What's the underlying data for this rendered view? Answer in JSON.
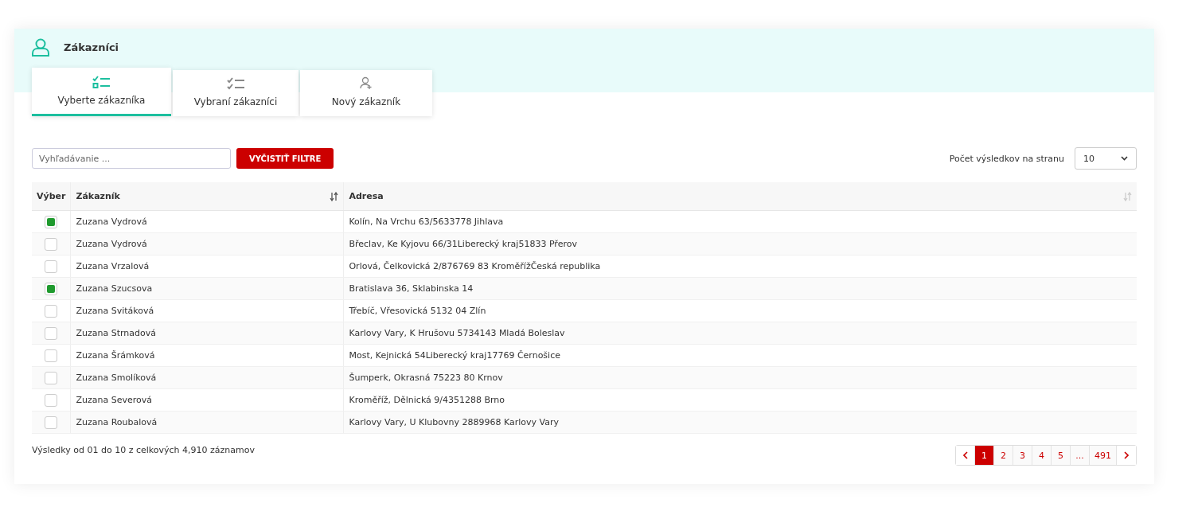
{
  "page": {
    "title": "Zákazníci"
  },
  "tabs": [
    {
      "label": "Vyberte zákazníka",
      "selected": true
    },
    {
      "label": "Vybraní zákazníci",
      "selected": false
    },
    {
      "label": "Nový zákazník",
      "selected": false
    }
  ],
  "search": {
    "placeholder": "Vyhľadávanie ..."
  },
  "clear_button": "VYČISTIŤ FILTRE",
  "page_size": {
    "label": "Počet výsledkov na stranu",
    "value": "10"
  },
  "table": {
    "columns": [
      {
        "label": "Výber"
      },
      {
        "label": "Zákazník",
        "sorted": true
      },
      {
        "label": "Adresa",
        "sorted": false
      }
    ],
    "rows": [
      {
        "checked": true,
        "customer": "Zuzana Vydrová",
        "address": "Kolín, Na Vrchu 63/5633778 Jihlava"
      },
      {
        "checked": false,
        "customer": "Zuzana Vydrová",
        "address": "Břeclav, Ke Kyjovu 66/31Liberecký kraj51833 Přerov"
      },
      {
        "checked": false,
        "customer": "Zuzana Vrzalová",
        "address": "Orlová, Čelkovická 2/876769 83 KroměřížČeská republika"
      },
      {
        "checked": true,
        "customer": "Zuzana Szucsova",
        "address": "Bratislava 36, Sklabinska 14"
      },
      {
        "checked": false,
        "customer": "Zuzana Svitáková",
        "address": "Třebíč, Vřesovická 5132 04 Zlín"
      },
      {
        "checked": false,
        "customer": "Zuzana Strnadová",
        "address": "Karlovy Vary, K Hrušovu 5734143 Mladá Boleslav"
      },
      {
        "checked": false,
        "customer": "Zuzana Šrámková",
        "address": "Most, Kejnická 54Liberecký kraj17769 Černošice"
      },
      {
        "checked": false,
        "customer": "Zuzana Smolíková",
        "address": "Šumperk, Okrasná 75223 80 Krnov"
      },
      {
        "checked": false,
        "customer": "Zuzana Severová",
        "address": "Kroměříž, Dělnická 9/4351288 Brno"
      },
      {
        "checked": false,
        "customer": "Zuzana Roubalová",
        "address": "Karlovy Vary, U Klubovny 2889968 Karlovy Vary"
      }
    ]
  },
  "summary": "Výsledky od 01 do 10 z celkových 4,910 záznamov",
  "pagination": {
    "pages": [
      {
        "label": "1",
        "selected": true
      },
      {
        "label": "2",
        "selected": false
      },
      {
        "label": "3",
        "selected": false
      },
      {
        "label": "4",
        "selected": false
      },
      {
        "label": "5",
        "selected": false
      },
      {
        "label": "...",
        "selected": false
      },
      {
        "label": "491",
        "selected": false
      }
    ]
  }
}
